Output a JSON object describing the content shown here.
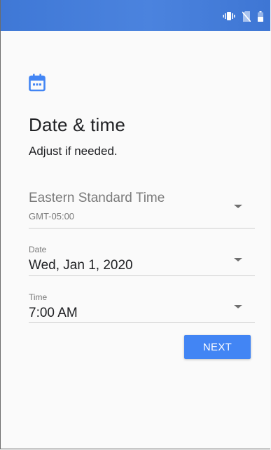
{
  "status_bar": {
    "color": "#4681dc",
    "icons": [
      "vibrate-icon",
      "no-sim-icon",
      "battery-icon"
    ]
  },
  "header": {
    "icon": "calendar-icon",
    "icon_color": "#4285f4",
    "title": "Date & time",
    "subtitle": "Adjust if needed."
  },
  "timezone": {
    "name": "Eastern Standard Time",
    "offset": "GMT-05:00"
  },
  "date": {
    "label": "Date",
    "value": "Wed, Jan 1, 2020"
  },
  "time": {
    "label": "Time",
    "value": "7:00 AM"
  },
  "next_button": {
    "label": "NEXT",
    "color": "#4285f4"
  }
}
